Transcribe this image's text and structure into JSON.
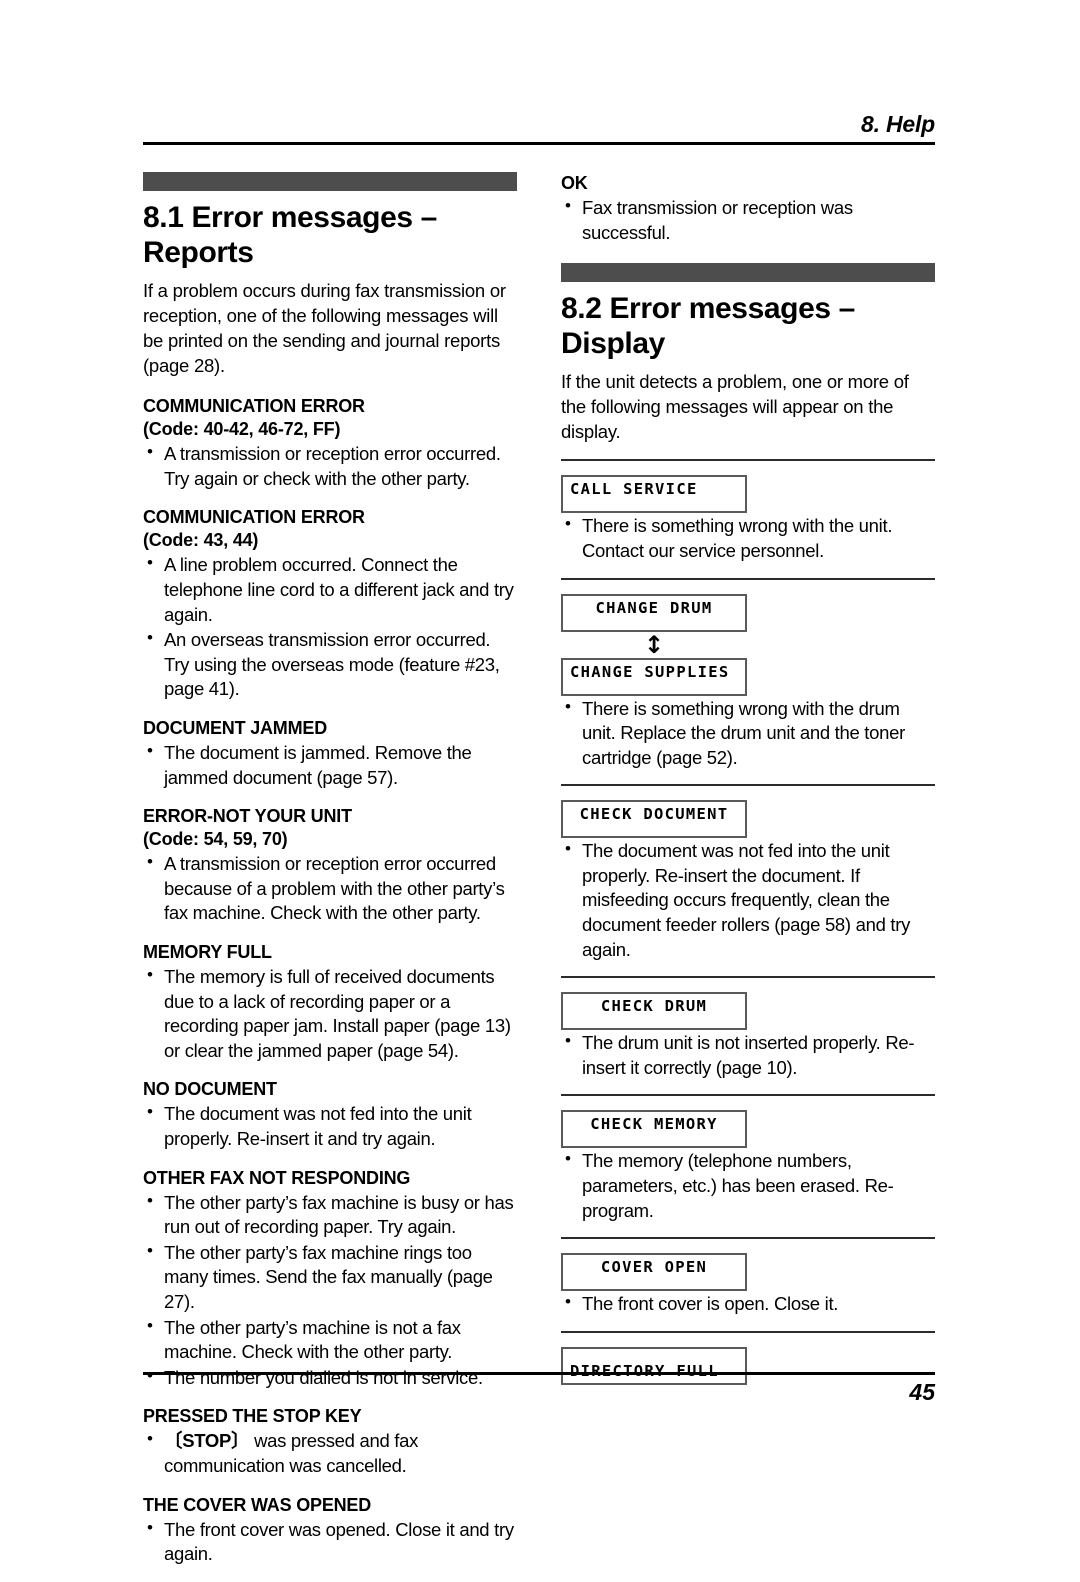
{
  "header": {
    "chapter_title": "8. Help"
  },
  "footer": {
    "page_number": "45"
  },
  "colors": {
    "section_bar": "#4d4d4d",
    "rule": "#000000",
    "lcd_border": "#5a5a5a"
  },
  "left_column": {
    "section": {
      "number_title": "8.1 Error messages – Reports",
      "intro": "If a problem occurs during fax transmission or reception, one of the following messages will be printed on the sending and journal reports (page 28)."
    },
    "messages": [
      {
        "name": "COMMUNICATION ERROR",
        "code": "(Code: 40-42, 46-72, FF)",
        "bullets": [
          "A transmission or reception error occurred. Try again or check with the other party."
        ]
      },
      {
        "name": "COMMUNICATION ERROR",
        "code": "(Code: 43, 44)",
        "bullets": [
          "A line problem occurred. Connect the telephone line cord to a different jack and try again.",
          "An overseas transmission error occurred. Try using the overseas mode (feature #23, page 41)."
        ]
      },
      {
        "name": "DOCUMENT JAMMED",
        "code": "",
        "bullets": [
          "The document is jammed. Remove the jammed document (page 57)."
        ]
      },
      {
        "name": "ERROR-NOT YOUR UNIT",
        "code": "(Code: 54, 59, 70)",
        "bullets": [
          "A transmission or reception error occurred because of a problem with the other party’s fax machine. Check with the other party."
        ]
      },
      {
        "name": "MEMORY FULL",
        "code": "",
        "bullets": [
          "The memory is full of received documents due to a lack of recording paper or a recording paper jam. Install paper (page 13) or clear the jammed paper (page 54)."
        ]
      },
      {
        "name": "NO DOCUMENT",
        "code": "",
        "bullets": [
          "The document was not fed into the unit properly. Re-insert it and try again."
        ]
      },
      {
        "name": "OTHER FAX NOT RESPONDING",
        "code": "",
        "bullets": [
          "The other party’s fax machine is busy or has run out of recording paper. Try again.",
          "The other party’s fax machine rings too many times. Send the fax manually (page 27).",
          "The other party’s machine is not a fax machine. Check with the other party.",
          "The number you dialled is not in service."
        ]
      },
      {
        "name": "PRESSED THE STOP KEY",
        "code": "",
        "bullets": [
          "〔STOP〕 was pressed and fax communication was cancelled."
        ],
        "bullet_key_prefix": "〔STOP〕",
        "bullet_key_rest": " was pressed and fax communication was cancelled."
      },
      {
        "name": "THE COVER WAS OPENED",
        "code": "",
        "bullets": [
          "The front cover was opened. Close it and try again."
        ]
      }
    ]
  },
  "right_column": {
    "ok_message": {
      "name": "OK",
      "bullets": [
        "Fax transmission or reception was successful."
      ]
    },
    "section": {
      "number_title": "8.2 Error messages – Display",
      "intro": "If the unit detects a problem, one or more of the following messages will appear on the display."
    },
    "display_messages": [
      {
        "lcd_lines": [
          "CALL SERVICE"
        ],
        "lcd_align": "left",
        "lcd_vertical": "top",
        "arrow": false,
        "bullets": [
          "There is something wrong with the unit. Contact our service personnel."
        ]
      },
      {
        "lcd_lines": [
          "CHANGE DRUM",
          "CHANGE SUPPLIES"
        ],
        "lcd_align_first": "center",
        "lcd_align_second": "left",
        "lcd_vertical": "top",
        "arrow": true,
        "arrow_glyph": "↕",
        "bullets": [
          "There is something wrong with the drum unit. Replace the drum unit and the toner cartridge (page 52)."
        ]
      },
      {
        "lcd_lines": [
          "CHECK DOCUMENT"
        ],
        "lcd_align": "center",
        "lcd_vertical": "top",
        "arrow": false,
        "bullets": [
          "The document was not fed into the unit properly. Re-insert the document. If misfeeding occurs frequently, clean the document feeder rollers (page 58) and try again."
        ]
      },
      {
        "lcd_lines": [
          "CHECK DRUM"
        ],
        "lcd_align": "center",
        "lcd_vertical": "top",
        "arrow": false,
        "bullets": [
          "The drum unit is not inserted properly. Re-insert it correctly (page 10)."
        ]
      },
      {
        "lcd_lines": [
          "CHECK MEMORY"
        ],
        "lcd_align": "center",
        "lcd_vertical": "top",
        "arrow": false,
        "bullets": [
          "The memory (telephone numbers, parameters, etc.) has been erased. Re-program."
        ]
      },
      {
        "lcd_lines": [
          "COVER OPEN"
        ],
        "lcd_align": "center",
        "lcd_vertical": "top",
        "arrow": false,
        "bullets": [
          "The front cover is open. Close it."
        ]
      },
      {
        "lcd_lines": [
          "DIRECTORY FULL"
        ],
        "lcd_align": "left",
        "lcd_vertical": "bottom",
        "arrow": false,
        "bullets": []
      }
    ]
  }
}
